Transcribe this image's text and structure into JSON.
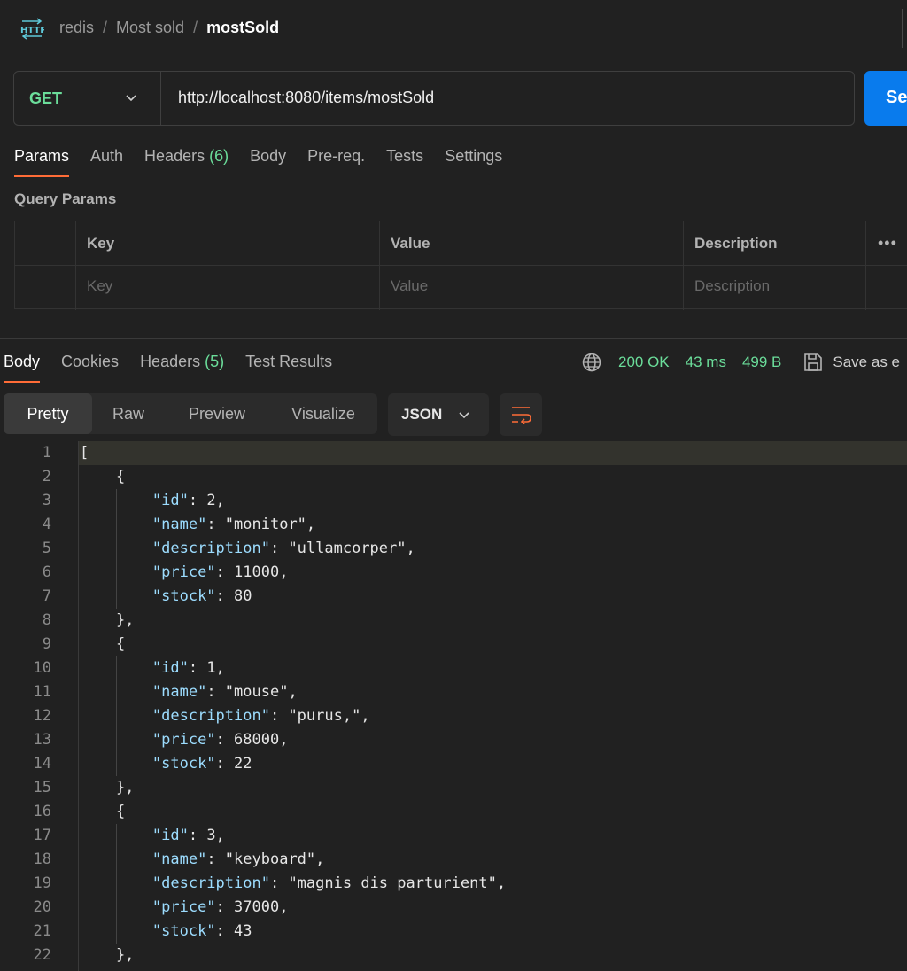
{
  "breadcrumb": {
    "items": [
      "redis",
      "Most sold"
    ],
    "current": "mostSold"
  },
  "request": {
    "method": "GET",
    "url": "http://localhost:8080/items/mostSold",
    "send_label": "Se"
  },
  "request_tabs": {
    "params": "Params",
    "auth": "Auth",
    "headers": "Headers",
    "headers_count": "(6)",
    "body": "Body",
    "prereq": "Pre-req.",
    "tests": "Tests",
    "settings": "Settings"
  },
  "query_params": {
    "title": "Query Params",
    "columns": [
      "Key",
      "Value",
      "Description"
    ],
    "placeholders": [
      "Key",
      "Value",
      "Description"
    ]
  },
  "response_tabs": {
    "body": "Body",
    "cookies": "Cookies",
    "headers": "Headers",
    "headers_count": "(5)",
    "test_results": "Test Results"
  },
  "status": {
    "code": "200 OK",
    "time": "43 ms",
    "size": "499 B",
    "save_label": "Save as e"
  },
  "format": {
    "modes": [
      "Pretty",
      "Raw",
      "Preview",
      "Visualize"
    ],
    "active": "Pretty",
    "language": "JSON"
  },
  "code_lines": [
    "[",
    "    {",
    "        \"id\": 2,",
    "        \"name\": \"monitor\",",
    "        \"description\": \"ullamcorper\",",
    "        \"price\": 11000,",
    "        \"stock\": 80",
    "    },",
    "    {",
    "        \"id\": 1,",
    "        \"name\": \"mouse\",",
    "        \"description\": \"purus,\",",
    "        \"price\": 68000,",
    "        \"stock\": 22",
    "    },",
    "    {",
    "        \"id\": 3,",
    "        \"name\": \"keyboard\",",
    "        \"description\": \"magnis dis parturient\",",
    "        \"price\": 37000,",
    "        \"stock\": 43",
    "    },"
  ],
  "colors": {
    "accent": "#ff6c37",
    "success": "#6bdd9a",
    "send": "#097bed"
  }
}
